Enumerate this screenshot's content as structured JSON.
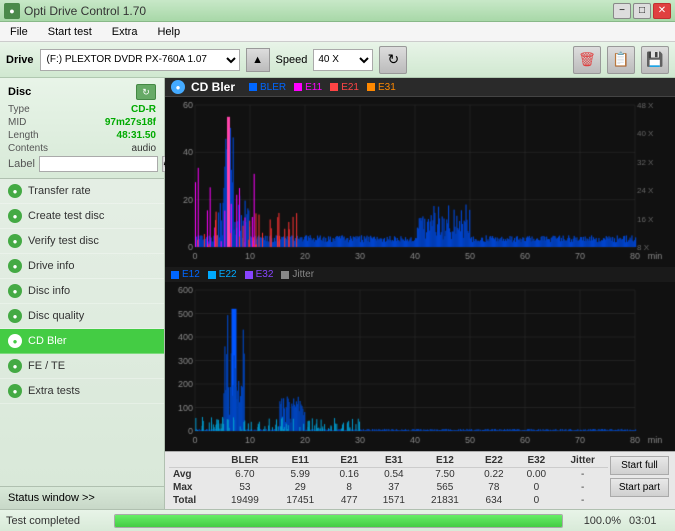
{
  "titlebar": {
    "title": "Opti Drive Control 1.70",
    "minimize": "−",
    "maximize": "□",
    "close": "✕"
  },
  "menubar": {
    "items": [
      "File",
      "Start test",
      "Extra",
      "Help"
    ]
  },
  "toolbar": {
    "drive_label": "Drive",
    "drive_value": "(F:)  PLEXTOR DVDR  PX-760A 1.07",
    "speed_label": "Speed",
    "speed_value": "40 X"
  },
  "disc": {
    "title": "Disc",
    "type_label": "Type",
    "type_value": "CD-R",
    "mid_label": "MID",
    "mid_value": "97m27s18f",
    "length_label": "Length",
    "length_value": "48:31.50",
    "contents_label": "Contents",
    "contents_value": "audio",
    "label_label": "Label"
  },
  "nav": {
    "items": [
      {
        "id": "transfer-rate",
        "label": "Transfer rate",
        "active": false
      },
      {
        "id": "create-test-disc",
        "label": "Create test disc",
        "active": false
      },
      {
        "id": "verify-test-disc",
        "label": "Verify test disc",
        "active": false
      },
      {
        "id": "drive-info",
        "label": "Drive info",
        "active": false
      },
      {
        "id": "disc-info",
        "label": "Disc info",
        "active": false
      },
      {
        "id": "disc-quality",
        "label": "Disc quality",
        "active": false
      },
      {
        "id": "cd-bler",
        "label": "CD Bler",
        "active": true
      },
      {
        "id": "fe-te",
        "label": "FE / TE",
        "active": false
      },
      {
        "id": "extra-tests",
        "label": "Extra tests",
        "active": false
      }
    ],
    "status_window": "Status window >>"
  },
  "chart": {
    "icon_color": "#44aaff",
    "title": "CD Bler",
    "upper_legend": [
      {
        "label": "BLER",
        "color": "#0066ff"
      },
      {
        "label": "E11",
        "color": "#ff00ff"
      },
      {
        "label": "E21",
        "color": "#ff4444"
      },
      {
        "label": "E31",
        "color": "#ff8800"
      }
    ],
    "lower_legend": [
      {
        "label": "E12",
        "color": "#0066ff"
      },
      {
        "label": "E22",
        "color": "#00aaff"
      },
      {
        "label": "E32",
        "color": "#8844ff"
      },
      {
        "label": "Jitter",
        "color": "#888888"
      }
    ],
    "upper_ymax": 60,
    "lower_ymax": 600,
    "xmax": 80,
    "x_axis_unit": "min"
  },
  "stats": {
    "columns": [
      "BLER",
      "E11",
      "E21",
      "E31",
      "E12",
      "E22",
      "E32",
      "Jitter"
    ],
    "rows": [
      {
        "label": "Avg",
        "values": [
          "6.70",
          "5.99",
          "0.16",
          "0.54",
          "7.50",
          "0.22",
          "0.00",
          "-"
        ]
      },
      {
        "label": "Max",
        "values": [
          "53",
          "29",
          "8",
          "37",
          "565",
          "78",
          "0",
          "-"
        ]
      },
      {
        "label": "Total",
        "values": [
          "19499",
          "17451",
          "477",
          "1571",
          "21831",
          "634",
          "0",
          "-"
        ]
      }
    ],
    "btn_start_full": "Start full",
    "btn_start_part": "Start part"
  },
  "statusbar": {
    "status_text": "Test completed",
    "progress_pct": "100.0%",
    "progress_time": "03:01",
    "progress_value": 100
  }
}
